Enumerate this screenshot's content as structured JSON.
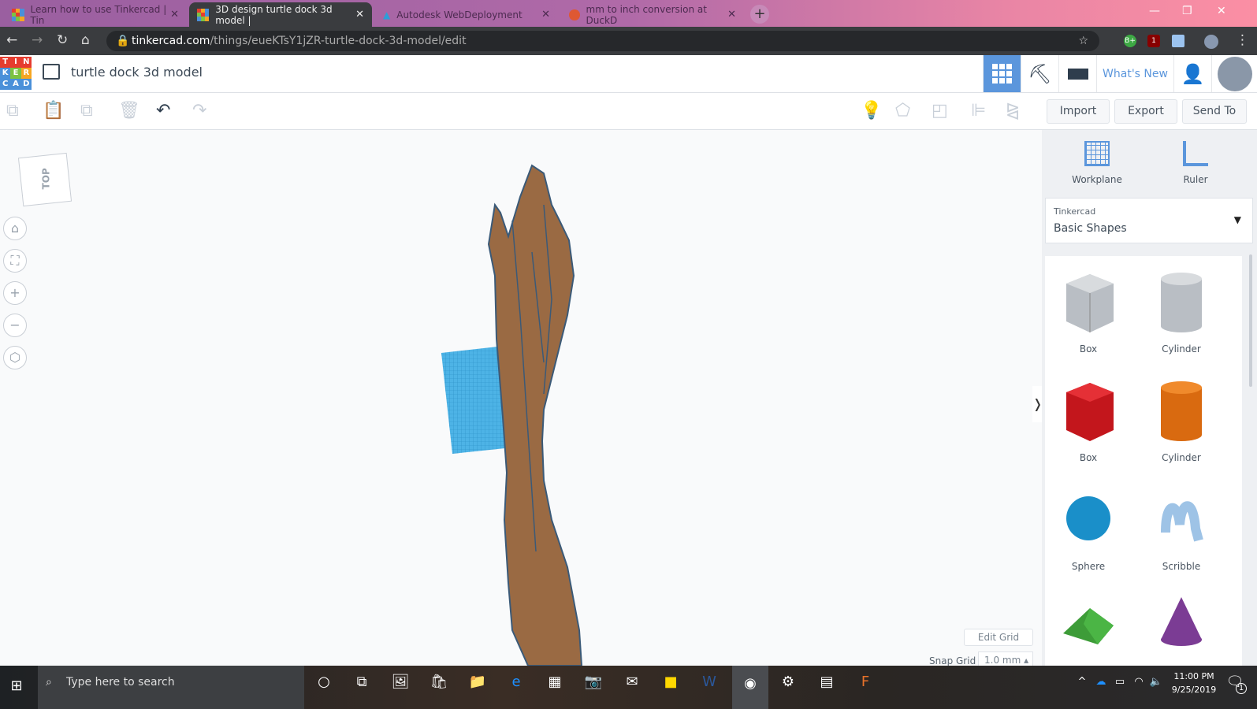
{
  "browser": {
    "tabs": [
      {
        "label": "Learn how to use Tinkercad | Tin",
        "active": false
      },
      {
        "label": "3D design turtle dock 3d model |",
        "active": true
      },
      {
        "label": "Autodesk WebDeployment",
        "active": false
      },
      {
        "label": "mm to inch conversion at DuckD",
        "active": false
      }
    ],
    "url_domain": "tinkercad.com",
    "url_path": "/things/eueKTsY1jZR-turtle-dock-3d-model/edit",
    "ext_badge": "1"
  },
  "app": {
    "logo_letters": [
      "T",
      "I",
      "N",
      "K",
      "E",
      "R",
      "C",
      "A",
      "D"
    ],
    "title": "turtle dock 3d model",
    "whats_new": "What's New",
    "accent": "#5b96dc"
  },
  "toolbar": {
    "import": "Import",
    "export": "Export",
    "send_to": "Send To"
  },
  "viewcube": {
    "face": "TOP"
  },
  "panel": {
    "workplane": "Workplane",
    "ruler": "Ruler",
    "library_source": "Tinkercad",
    "library_name": "Basic Shapes",
    "shapes": [
      {
        "label": "Box"
      },
      {
        "label": "Cylinder"
      },
      {
        "label": "Box"
      },
      {
        "label": "Cylinder"
      },
      {
        "label": "Sphere"
      },
      {
        "label": "Scribble"
      }
    ]
  },
  "grid": {
    "edit_grid": "Edit Grid",
    "snap_label": "Snap Grid",
    "snap_value": "1.0 mm"
  },
  "taskbar": {
    "search_placeholder": "Type here to search",
    "time": "11:00 PM",
    "date": "9/25/2019",
    "notif_count": "1"
  }
}
